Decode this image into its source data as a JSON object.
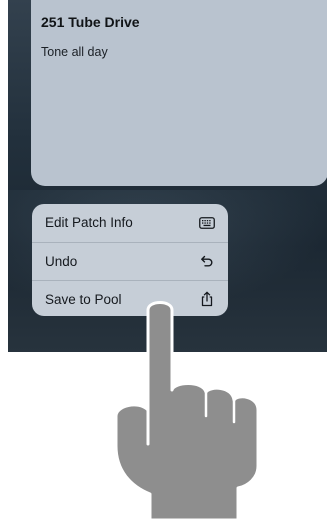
{
  "card": {
    "title": "251 Tube Drive",
    "subtitle": "Tone all day"
  },
  "menu": {
    "items": [
      {
        "label": "Edit Patch Info",
        "icon": "keyboard-icon"
      },
      {
        "label": "Undo",
        "icon": "undo-arrow-icon"
      },
      {
        "label": "Save to Pool",
        "icon": "share-icon"
      }
    ]
  },
  "colors": {
    "background": "#23303b",
    "card": "#b9c3cf",
    "menu": "#c6ced7",
    "hand": "#8e8e8e"
  }
}
